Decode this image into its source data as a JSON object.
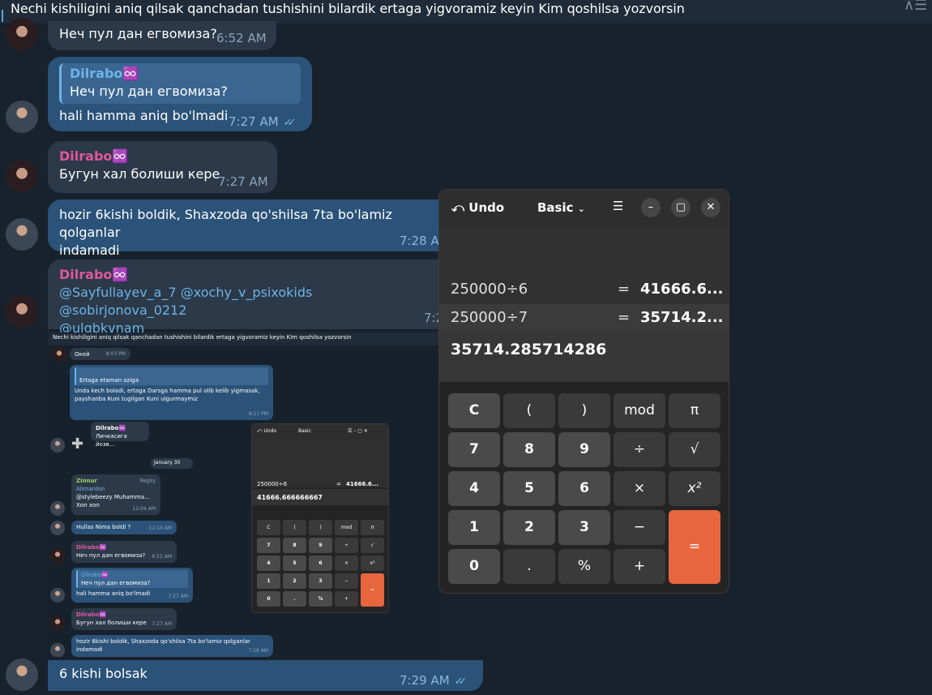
{
  "pinned_message": "Nechi kishiligini aniq qilsak qanchadan tushishini bilardik ertaga yigvoramiz keyin Kim qoshilsa yozvorsin",
  "messages": [
    {
      "text": "Неч пул дан егвомиза?",
      "time": "6:52 AM"
    },
    {
      "quote_name": "Dilrabo♾️",
      "quote_text": "Неч пул дан егвомиза?",
      "text": "hali hamma aniq bo'lmadi",
      "time": "7:27 AM"
    },
    {
      "name": "Dilrabo♾️",
      "text": "Бугун хал болиши кере",
      "time": "7:27 AM"
    },
    {
      "text_line1": "hozir 6kishi boldik, Shaxzoda qo'shilsa 7ta bo'lamiz qolganlar",
      "text_line2": "indamadi",
      "time": "7:28 AM"
    },
    {
      "name": "Dilrabo♾️",
      "mention1": "@Sayfullayev_a_7",
      "mention2": "@xochy_v_psixokids",
      "mention3": "@sobirjonova_0212",
      "mention4": "@ulgbkvnam",
      "time": "7:2"
    },
    {
      "text": "6 kishi bolsak",
      "time": "7:29 AM"
    }
  ],
  "embedded_screenshot": {
    "pin": "Nechi kishiligini aniq qilsak qanchadan tushishini bilardik ertaga yigvoramiz keyin Kim qoshilsa yozvorsin",
    "m1": "Окей",
    "m1_time": "8:03 PM",
    "m2_quote": "Ertaga etaman oziga",
    "m2_line1": "Unda kech boladi, ertaga Darsga hamma pul olib kelib yigmasak,",
    "m2_line2": "payshanba Kuni tugilgan Kuni ulgurmaymiz",
    "m2_time": "8:11 PM",
    "m3_name": "Dilrabo♾️",
    "m3_text": "Личкасига йозв...",
    "date": "January 30",
    "m4_name": "Zinnur",
    "m4_reply": "Reply",
    "m4_quote": "Alimardon",
    "m4_quote2": "@stylebeezy Muhamma...",
    "m4_text": "Хоп хоп",
    "m4_time": "12:04 AM",
    "m5_text": "Hullas Nima boldi ?",
    "m5_time": "12:10 AM",
    "m6_name": "Dilrabo♾️",
    "m6_text": "Неч пул дан егвомиза?",
    "m6_time": "6:52 AM",
    "m7_quote_name": "Dilrabo♾️",
    "m7_quote": "Неч пул дан егвомиза?",
    "m7_text": "hali hamma aniq bo'lmadi",
    "m7_time": "7:27 AM",
    "m8_name": "Dilrabo♾️",
    "m8_text": "Бугун хал болиши кере",
    "m8_time": "7:27 AM",
    "m9_line1": "hozir 6kishi boldik, Shaxzoda qo'shilsa 7ta bo'lamiz qolganlar",
    "m9_line2": "indamadi",
    "m9_time": "7:28 AM",
    "calc_undo": "Undo",
    "calc_mode": "Basic",
    "calc_hist_expr": "250000÷6",
    "calc_hist_res": "41666.6...",
    "calc_entry": "41666.666666667",
    "keys": [
      "C",
      "(",
      ")",
      "mod",
      "π",
      "7",
      "8",
      "9",
      "÷",
      "√",
      "4",
      "5",
      "6",
      "×",
      "x²",
      "1",
      "2",
      "3",
      "−",
      "=",
      "0",
      ".",
      "%",
      "+"
    ]
  },
  "calculator": {
    "undo_label": "Undo",
    "mode_label": "Basic",
    "history": [
      {
        "expr": "250000÷6",
        "eq": "=",
        "result": "41666.6..."
      },
      {
        "expr": "250000÷7",
        "eq": "=",
        "result": "35714.2..."
      }
    ],
    "entry": "35714.285714286",
    "keys": {
      "clear": "C",
      "lparen": "(",
      "rparen": ")",
      "mod": "mod",
      "pi": "π",
      "k7": "7",
      "k8": "8",
      "k9": "9",
      "divide": "÷",
      "sqrt": "√",
      "k4": "4",
      "k5": "5",
      "k6": "6",
      "multiply": "×",
      "square": "x²",
      "k1": "1",
      "k2": "2",
      "k3": "3",
      "minus": "−",
      "equals": "=",
      "k0": "0",
      "dot": ".",
      "percent": "%",
      "plus": "+"
    }
  }
}
